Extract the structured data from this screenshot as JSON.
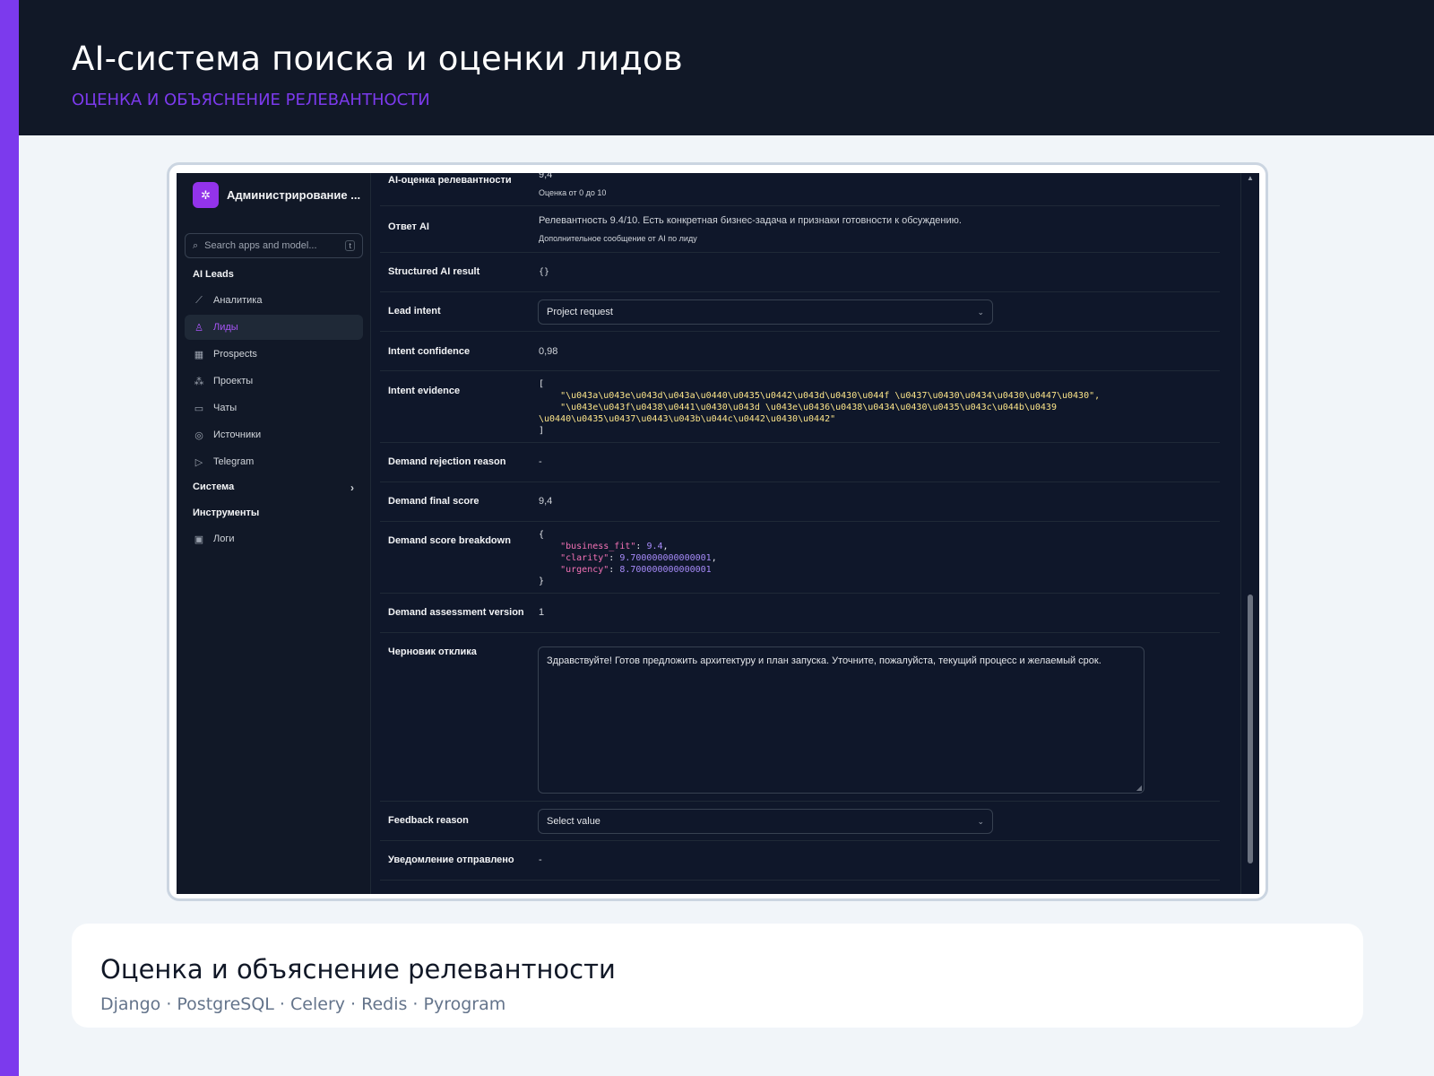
{
  "page": {
    "title": "AI-система поиска и оценки лидов",
    "subtitle": "ОЦЕНКА И ОБЪЯСНЕНИЕ РЕЛЕВАНТНОСТИ",
    "accent_color": "#7c3aed"
  },
  "sidebar": {
    "brand": "Администрирование ...",
    "brand_icon": "gear-icon",
    "search_placeholder": "Search apps and model...",
    "search_shortcut": "t",
    "group_ai_leads": "AI Leads",
    "items": [
      {
        "label": "Аналитика",
        "icon": "chart-icon"
      },
      {
        "label": "Лиды",
        "icon": "users-icon",
        "active": true
      },
      {
        "label": "Prospects",
        "icon": "building-icon"
      },
      {
        "label": "Проекты",
        "icon": "nodes-icon"
      },
      {
        "label": "Чаты",
        "icon": "chat-icon"
      },
      {
        "label": "Источники",
        "icon": "radar-icon"
      },
      {
        "label": "Telegram",
        "icon": "send-icon"
      }
    ],
    "group_system": "Система",
    "group_tools": "Инструменты",
    "logs": "Логи"
  },
  "form": {
    "ai_score_label": "AI-оценка релевантности",
    "ai_score_value": "9,4",
    "ai_score_hint": "Оценка от 0 до 10",
    "ai_answer_label": "Ответ AI",
    "ai_answer_value": "Релевантность 9.4/10. Есть конкретная бизнес-задача и признаки готовности к обсуждению.",
    "ai_answer_hint": "Дополнительное сообщение от AI по лиду",
    "structured_label": "Structured AI result",
    "structured_value": "{}",
    "lead_intent_label": "Lead intent",
    "lead_intent_value": "Project request",
    "intent_conf_label": "Intent confidence",
    "intent_conf_value": "0,98",
    "intent_evidence_label": "Intent evidence",
    "intent_evidence_open": "[",
    "intent_evidence_1": "    \"\\u043a\\u043e\\u043d\\u043a\\u0440\\u0435\\u0442\\u043d\\u0430\\u044f \\u0437\\u0430\\u0434\\u0430\\u0447\\u0430\",",
    "intent_evidence_2a": "    \"\\u043e\\u043f\\u0438\\u0441\\u0430\\u043d \\u043e\\u0436\\u0438\\u0434\\u0430\\u0435\\u043c\\u044b\\u0439",
    "intent_evidence_2b": "\\u0440\\u0435\\u0437\\u0443\\u043b\\u044c\\u0442\\u0430\\u0442\"",
    "intent_evidence_close": "]",
    "rejection_label": "Demand rejection reason",
    "rejection_value": "-",
    "final_score_label": "Demand final score",
    "final_score_value": "9,4",
    "breakdown_label": "Demand score breakdown",
    "breakdown": [
      {
        "key": "\"business_fit\"",
        "value": "9.4",
        "sep": ","
      },
      {
        "key": "\"clarity\"",
        "value": "9.700000000000001",
        "sep": ","
      },
      {
        "key": "\"urgency\"",
        "value": "8.700000000000001",
        "sep": ""
      }
    ],
    "brace_open": "{",
    "brace_close": "}",
    "version_label": "Demand assessment version",
    "version_value": "1",
    "draft_label": "Черновик отклика",
    "draft_value": "Здравствуйте! Готов предложить архитектуру и план запуска. Уточните, пожалуйста, текущий процесс и желаемый срок.",
    "feedback_label": "Feedback reason",
    "feedback_value": "Select value",
    "notified_label": "Уведомление отправлено",
    "notified_value": "-"
  },
  "caption": {
    "title": "Оценка и объяснение релевантности",
    "tech": "Django · PostgreSQL · Celery · Redis · Pyrogram"
  }
}
